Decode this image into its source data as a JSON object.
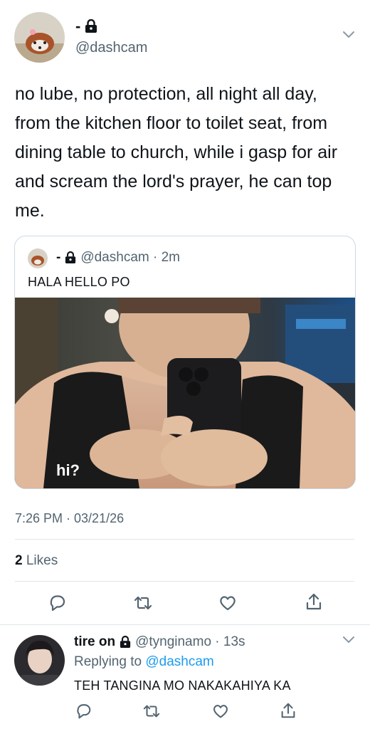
{
  "main_tweet": {
    "display_name": "-",
    "handle": "@dashcam",
    "text": "no lube, no protection, all night all day, from the kitchen floor to toilet seat, from dining table to church, while i gasp for air and scream the lord's prayer, he can top me.",
    "timestamp": "7:26 PM · 03/21/26",
    "likes_count": "2",
    "likes_label": "Likes"
  },
  "quoted_tweet": {
    "display_name": "-",
    "handle_time": "@dashcam · 2m",
    "text": "HALA HELLO PO",
    "media_caption": "hi?"
  },
  "reply": {
    "display_name": "tire on",
    "handle_time": "@tynginamo · 13s",
    "replying_prefix": "Replying to",
    "replying_to": "@dashcam",
    "text": "TEH TANGINA MO NAKAKAHIYA KA"
  },
  "icons": {
    "lock": "lock-icon",
    "more": "chevron-down-icon",
    "reply": "reply-icon",
    "retweet": "retweet-icon",
    "like": "heart-icon",
    "share": "share-icon"
  },
  "colors": {
    "text": "#0f1419",
    "secondary": "#536471",
    "accent": "#1d9bf0",
    "divider": "#e1e6ea"
  }
}
